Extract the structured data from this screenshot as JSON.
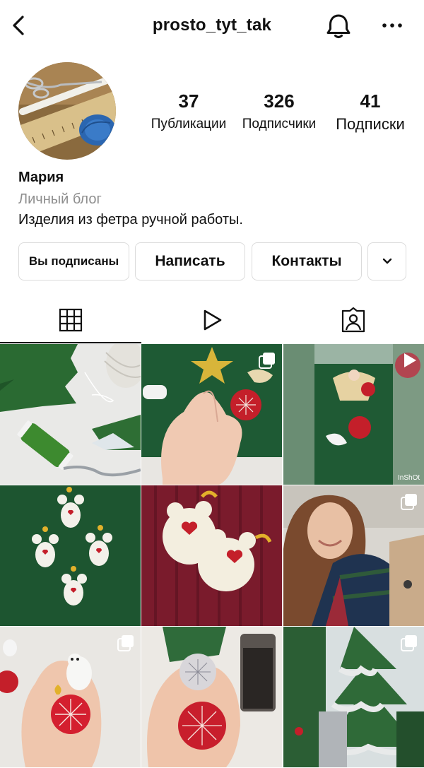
{
  "header": {
    "username": "prosto_tyt_tak"
  },
  "profile": {
    "stats": {
      "posts": {
        "count": "37",
        "label": "Публикации"
      },
      "followers": {
        "count": "326",
        "label": "Подписчики"
      },
      "following": {
        "count": "41",
        "label": "Подписки"
      }
    },
    "name": "Мария",
    "category": "Личный блог",
    "bio": "Изделия из фетра ручной работы."
  },
  "actions": {
    "following_label": "Вы подписаны",
    "message_label": "Написать",
    "contacts_label": "Контакты"
  },
  "tabs": [
    "grid-icon",
    "reels-icon",
    "tagged-icon"
  ],
  "grid": {
    "posts": [
      {
        "name": "post-felt-tree-thread",
        "badge": "none"
      },
      {
        "name": "post-star-ornament",
        "badge": "carousel"
      },
      {
        "name": "post-angel-video",
        "badge": "video",
        "watermark": "InShOt"
      },
      {
        "name": "post-white-bears",
        "badge": "none"
      },
      {
        "name": "post-bears-burgundy",
        "badge": "none"
      },
      {
        "name": "post-selfie",
        "badge": "carousel"
      },
      {
        "name": "post-owl-ornament",
        "badge": "carousel"
      },
      {
        "name": "post-snowflake-discs",
        "badge": "none"
      },
      {
        "name": "post-felt-fir",
        "badge": "carousel"
      }
    ]
  },
  "colors": {
    "text": "#111111",
    "muted": "#8e8e8e",
    "border": "#dbdbdb",
    "felt_green": "#1f5a2e",
    "felt_red": "#c41f2a"
  }
}
